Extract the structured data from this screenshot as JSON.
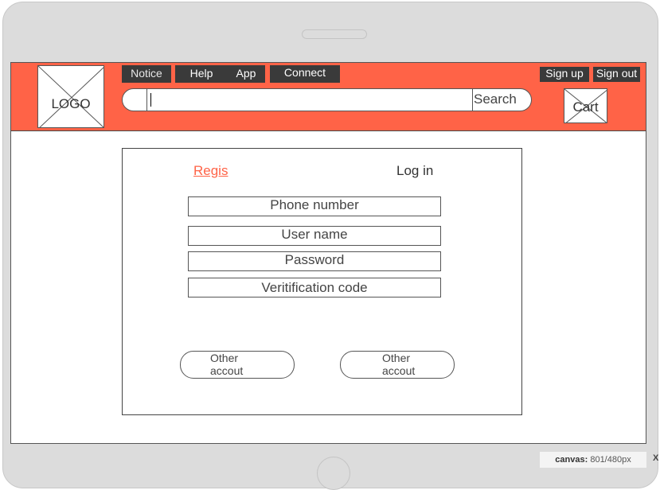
{
  "header": {
    "logo_label": "LOGO",
    "nav": [
      "Notice",
      "Help",
      "App",
      "Connect"
    ],
    "sign_up": "Sign up",
    "sign_out": "Sign out",
    "search_button": "Search",
    "search_value": "",
    "cart_label": "Cart",
    "accent_color": "#ff6347"
  },
  "login": {
    "tab_register": "Regis",
    "tab_login": "Log in",
    "fields": [
      "Phone number",
      "User name",
      "Password",
      "Veritification code"
    ],
    "other_account_1": [
      "Other",
      "accout"
    ],
    "other_account_2": [
      "Other",
      "accout"
    ]
  },
  "canvas_info": {
    "label": "canvas:",
    "value": "801/480px",
    "close": "X"
  }
}
